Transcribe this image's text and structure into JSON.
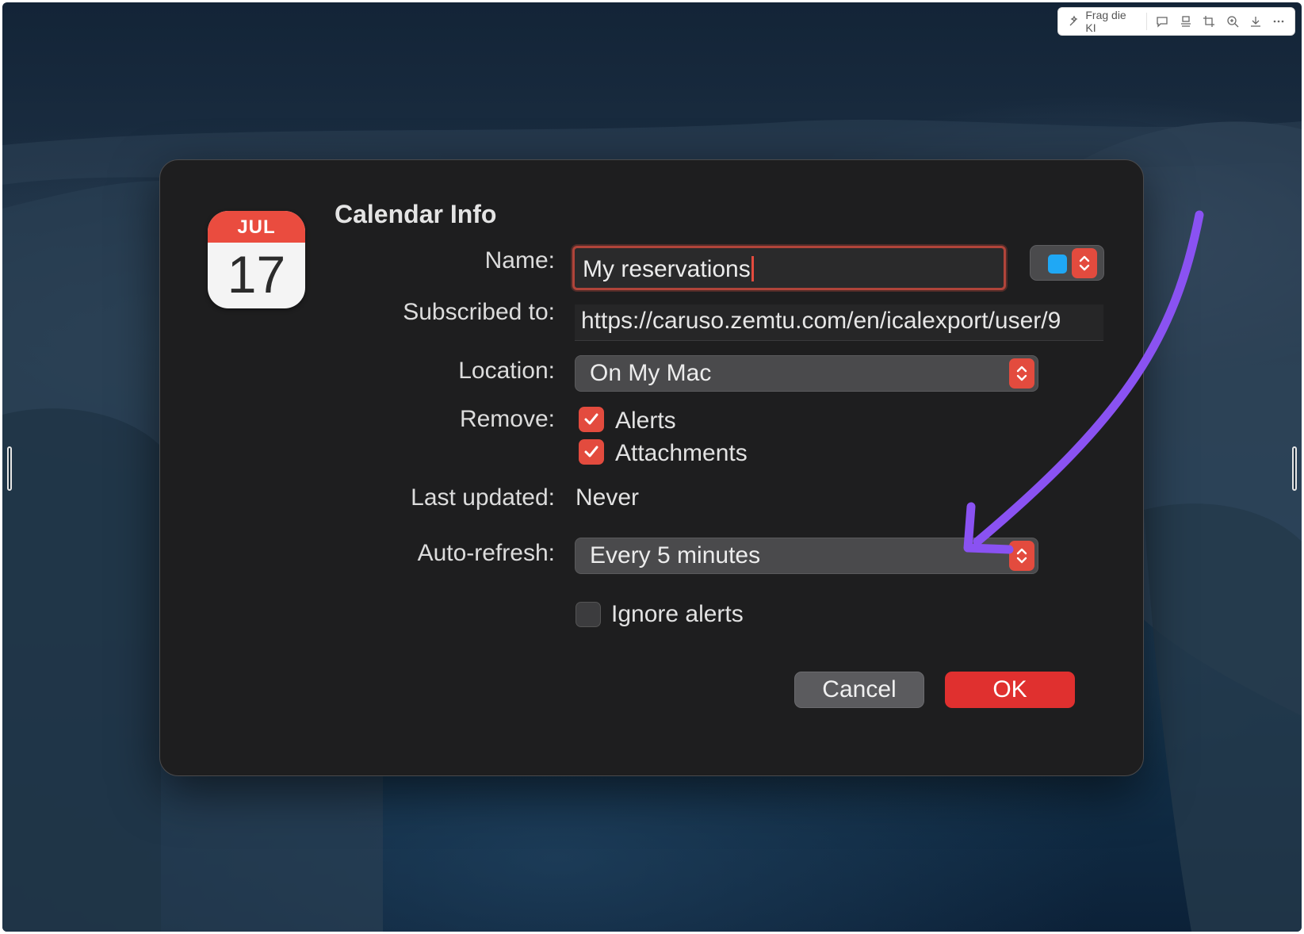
{
  "overlay_toolbar": {
    "ki_label": "Frag die KI",
    "icons": [
      "sparkle-icon",
      "comment-icon",
      "stamp-icon",
      "crop-icon",
      "zoom-icon",
      "download-icon",
      "more-icon"
    ]
  },
  "dialog": {
    "title": "Calendar Info",
    "app_icon": {
      "month": "JUL",
      "day": "17"
    },
    "name": {
      "label": "Name:",
      "value": "My reservations"
    },
    "color": {
      "swatch": "#1fa8f5"
    },
    "subscribed": {
      "label": "Subscribed to:",
      "value": "https://caruso.zemtu.com/en/icalexport/user/9"
    },
    "location": {
      "label": "Location:",
      "value": "On My Mac"
    },
    "remove": {
      "label": "Remove:",
      "options": [
        {
          "label": "Alerts",
          "checked": true
        },
        {
          "label": "Attachments",
          "checked": true
        }
      ]
    },
    "last_updated": {
      "label": "Last updated:",
      "value": "Never"
    },
    "auto_refresh": {
      "label": "Auto-refresh:",
      "value": "Every 5 minutes"
    },
    "ignore_alerts": {
      "label": "Ignore alerts",
      "checked": false
    },
    "buttons": {
      "cancel": "Cancel",
      "ok": "OK"
    }
  },
  "colors": {
    "accent": "#e34b3e",
    "ok_button": "#e0302f",
    "annotation_arrow": "#8a52f2"
  }
}
